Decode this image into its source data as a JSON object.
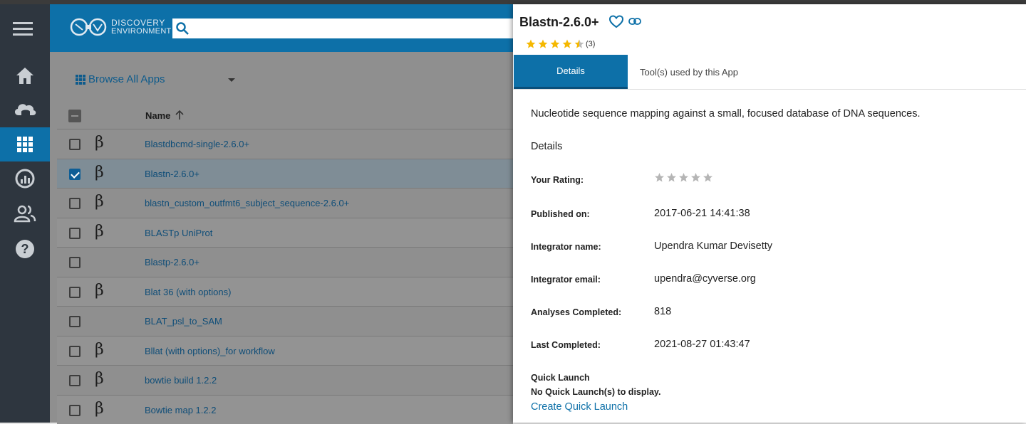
{
  "header": {
    "logo_line1": "DISCOVERY",
    "logo_line2": "ENVIRONMENT",
    "search_value": ""
  },
  "nav": {
    "items": [
      "home",
      "data",
      "apps",
      "analyses",
      "teams",
      "help"
    ],
    "active": "apps"
  },
  "apps_list": {
    "browse_label": "Browse All Apps",
    "name_header": "Name",
    "rows": [
      {
        "name": "Blastdbcmd-single-2.6.0+",
        "beta": "β",
        "checked": false
      },
      {
        "name": "Blastn-2.6.0+",
        "beta": "β",
        "checked": true
      },
      {
        "name": "blastn_custom_outfmt6_subject_sequence-2.6.0+",
        "beta": "β",
        "checked": false
      },
      {
        "name": "BLASTp UniProt",
        "beta": "β",
        "checked": false
      },
      {
        "name": "Blastp-2.6.0+",
        "beta": "",
        "checked": false
      },
      {
        "name": "Blat 36 (with options)",
        "beta": "β",
        "checked": false
      },
      {
        "name": "BLAT_psl_to_SAM",
        "beta": "",
        "checked": false
      },
      {
        "name": "Bllat (with options)_for workflow",
        "beta": "β",
        "checked": false
      },
      {
        "name": "bowtie build 1.2.2",
        "beta": "β",
        "checked": false
      },
      {
        "name": "Bowtie map 1.2.2",
        "beta": "β",
        "checked": false
      }
    ]
  },
  "details_panel": {
    "title": "Blastn-2.6.0+",
    "rating_count": "(3)",
    "average_rating": 4.5,
    "tabs": [
      "Details",
      "Tool(s) used by this App"
    ],
    "description": "Nucleotide sequence mapping against a small, focused database of DNA sequences.",
    "section_title": "Details",
    "fields": {
      "your_rating_label": "Your Rating:",
      "published_label": "Published on:",
      "published_value": "2017-06-21 14:41:38",
      "integrator_name_label": "Integrator name:",
      "integrator_name_value": "Upendra Kumar Devisetty",
      "integrator_email_label": "Integrator email:",
      "integrator_email_value": "upendra@cyverse.org",
      "analyses_label": "Analyses Completed:",
      "analyses_value": "818",
      "last_completed_label": "Last Completed:",
      "last_completed_value": "2021-08-27 01:43:47"
    },
    "quick_launch": {
      "title": "Quick Launch",
      "none_text": "No Quick Launch(s) to display.",
      "create_label": "Create Quick Launch"
    }
  },
  "colors": {
    "primary": "#0d70a8",
    "nav_bg": "#2e363f",
    "star": "#f5b800"
  }
}
